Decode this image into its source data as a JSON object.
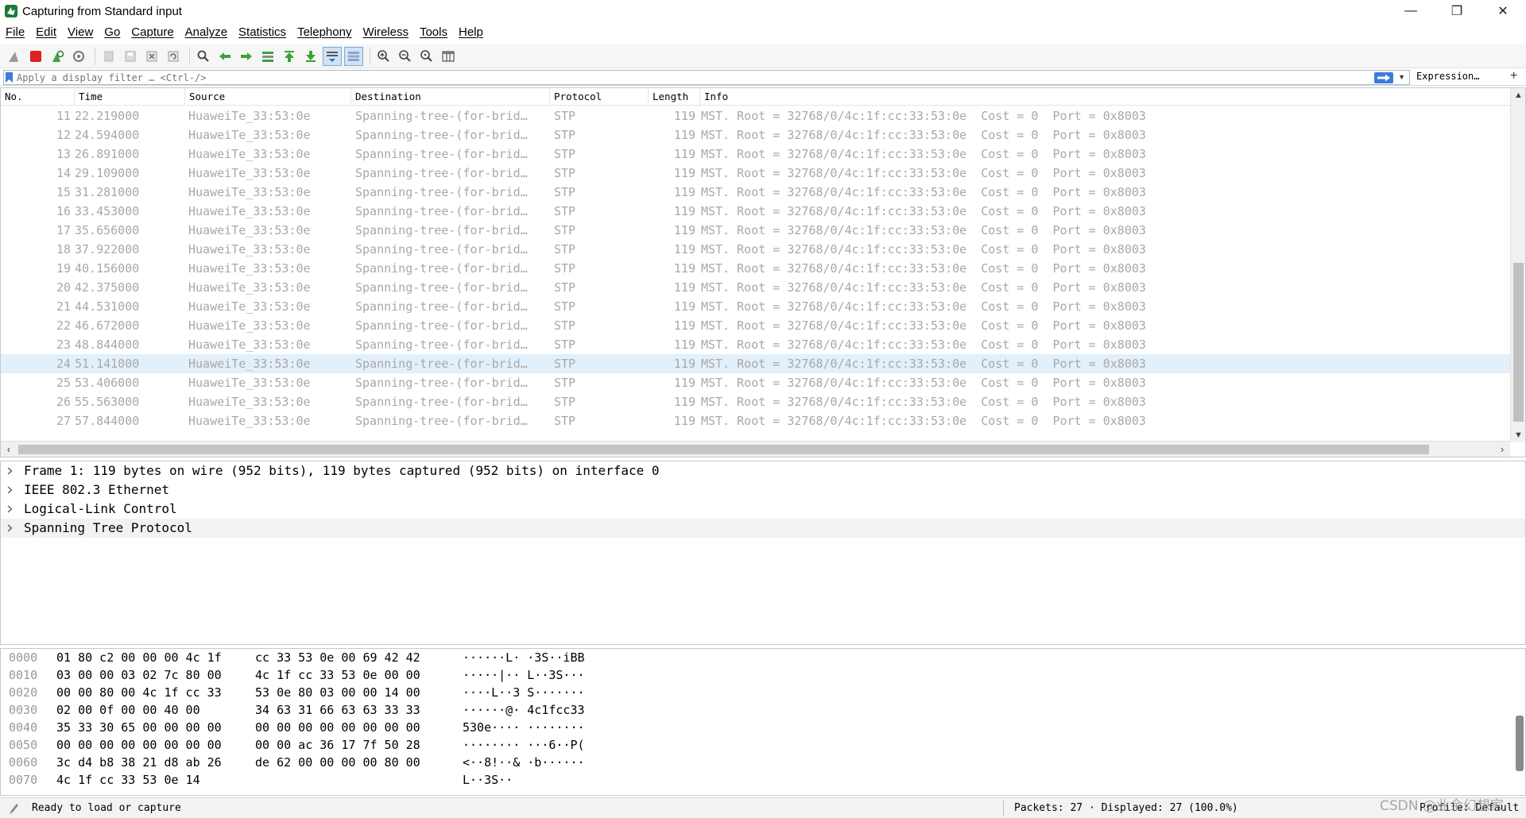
{
  "window": {
    "title": "Capturing from Standard input",
    "controls": [
      "—",
      "❐",
      "✕"
    ]
  },
  "menu": [
    "File",
    "Edit",
    "View",
    "Go",
    "Capture",
    "Analyze",
    "Statistics",
    "Telephony",
    "Wireless",
    "Tools",
    "Help"
  ],
  "toolbar": {
    "icons": [
      "shark-fin-start-icon",
      "stop-capture-icon",
      "restart-capture-icon",
      "capture-options-icon",
      "open-file-icon",
      "save-file-icon",
      "close-file-icon",
      "reload-file-icon",
      "find-packet-icon",
      "go-back-icon",
      "go-forward-icon",
      "go-to-packet-icon",
      "go-first-icon",
      "go-last-icon",
      "auto-scroll-icon",
      "colorize-icon",
      "zoom-in-icon",
      "zoom-out-icon",
      "zoom-normal-icon",
      "resize-columns-icon"
    ]
  },
  "filter": {
    "placeholder": "Apply a display filter … <Ctrl-/>",
    "expression_label": "Expression…",
    "plus_label": "+"
  },
  "packet_list": {
    "columns": [
      "No.",
      "Time",
      "Source",
      "Destination",
      "Protocol",
      "Length",
      "Info"
    ],
    "selected_index": 13,
    "rows": [
      {
        "no": "11",
        "time": "22.219000",
        "src": "HuaweiTe_33:53:0e",
        "dst": "Spanning-tree-(for-brid…",
        "proto": "STP",
        "len": "119",
        "info": "MST. Root = 32768/0/4c:1f:cc:33:53:0e  Cost = 0  Port = 0x8003"
      },
      {
        "no": "12",
        "time": "24.594000",
        "src": "HuaweiTe_33:53:0e",
        "dst": "Spanning-tree-(for-brid…",
        "proto": "STP",
        "len": "119",
        "info": "MST. Root = 32768/0/4c:1f:cc:33:53:0e  Cost = 0  Port = 0x8003"
      },
      {
        "no": "13",
        "time": "26.891000",
        "src": "HuaweiTe_33:53:0e",
        "dst": "Spanning-tree-(for-brid…",
        "proto": "STP",
        "len": "119",
        "info": "MST. Root = 32768/0/4c:1f:cc:33:53:0e  Cost = 0  Port = 0x8003"
      },
      {
        "no": "14",
        "time": "29.109000",
        "src": "HuaweiTe_33:53:0e",
        "dst": "Spanning-tree-(for-brid…",
        "proto": "STP",
        "len": "119",
        "info": "MST. Root = 32768/0/4c:1f:cc:33:53:0e  Cost = 0  Port = 0x8003"
      },
      {
        "no": "15",
        "time": "31.281000",
        "src": "HuaweiTe_33:53:0e",
        "dst": "Spanning-tree-(for-brid…",
        "proto": "STP",
        "len": "119",
        "info": "MST. Root = 32768/0/4c:1f:cc:33:53:0e  Cost = 0  Port = 0x8003"
      },
      {
        "no": "16",
        "time": "33.453000",
        "src": "HuaweiTe_33:53:0e",
        "dst": "Spanning-tree-(for-brid…",
        "proto": "STP",
        "len": "119",
        "info": "MST. Root = 32768/0/4c:1f:cc:33:53:0e  Cost = 0  Port = 0x8003"
      },
      {
        "no": "17",
        "time": "35.656000",
        "src": "HuaweiTe_33:53:0e",
        "dst": "Spanning-tree-(for-brid…",
        "proto": "STP",
        "len": "119",
        "info": "MST. Root = 32768/0/4c:1f:cc:33:53:0e  Cost = 0  Port = 0x8003"
      },
      {
        "no": "18",
        "time": "37.922000",
        "src": "HuaweiTe_33:53:0e",
        "dst": "Spanning-tree-(for-brid…",
        "proto": "STP",
        "len": "119",
        "info": "MST. Root = 32768/0/4c:1f:cc:33:53:0e  Cost = 0  Port = 0x8003"
      },
      {
        "no": "19",
        "time": "40.156000",
        "src": "HuaweiTe_33:53:0e",
        "dst": "Spanning-tree-(for-brid…",
        "proto": "STP",
        "len": "119",
        "info": "MST. Root = 32768/0/4c:1f:cc:33:53:0e  Cost = 0  Port = 0x8003"
      },
      {
        "no": "20",
        "time": "42.375000",
        "src": "HuaweiTe_33:53:0e",
        "dst": "Spanning-tree-(for-brid…",
        "proto": "STP",
        "len": "119",
        "info": "MST. Root = 32768/0/4c:1f:cc:33:53:0e  Cost = 0  Port = 0x8003"
      },
      {
        "no": "21",
        "time": "44.531000",
        "src": "HuaweiTe_33:53:0e",
        "dst": "Spanning-tree-(for-brid…",
        "proto": "STP",
        "len": "119",
        "info": "MST. Root = 32768/0/4c:1f:cc:33:53:0e  Cost = 0  Port = 0x8003"
      },
      {
        "no": "22",
        "time": "46.672000",
        "src": "HuaweiTe_33:53:0e",
        "dst": "Spanning-tree-(for-brid…",
        "proto": "STP",
        "len": "119",
        "info": "MST. Root = 32768/0/4c:1f:cc:33:53:0e  Cost = 0  Port = 0x8003"
      },
      {
        "no": "23",
        "time": "48.844000",
        "src": "HuaweiTe_33:53:0e",
        "dst": "Spanning-tree-(for-brid…",
        "proto": "STP",
        "len": "119",
        "info": "MST. Root = 32768/0/4c:1f:cc:33:53:0e  Cost = 0  Port = 0x8003"
      },
      {
        "no": "24",
        "time": "51.141000",
        "src": "HuaweiTe_33:53:0e",
        "dst": "Spanning-tree-(for-brid…",
        "proto": "STP",
        "len": "119",
        "info": "MST. Root = 32768/0/4c:1f:cc:33:53:0e  Cost = 0  Port = 0x8003"
      },
      {
        "no": "25",
        "time": "53.406000",
        "src": "HuaweiTe_33:53:0e",
        "dst": "Spanning-tree-(for-brid…",
        "proto": "STP",
        "len": "119",
        "info": "MST. Root = 32768/0/4c:1f:cc:33:53:0e  Cost = 0  Port = 0x8003"
      },
      {
        "no": "26",
        "time": "55.563000",
        "src": "HuaweiTe_33:53:0e",
        "dst": "Spanning-tree-(for-brid…",
        "proto": "STP",
        "len": "119",
        "info": "MST. Root = 32768/0/4c:1f:cc:33:53:0e  Cost = 0  Port = 0x8003"
      },
      {
        "no": "27",
        "time": "57.844000",
        "src": "HuaweiTe_33:53:0e",
        "dst": "Spanning-tree-(for-brid…",
        "proto": "STP",
        "len": "119",
        "info": "MST. Root = 32768/0/4c:1f:cc:33:53:0e  Cost = 0  Port = 0x8003"
      }
    ]
  },
  "details": [
    "Frame 1: 119 bytes on wire (952 bits), 119 bytes captured (952 bits) on interface 0",
    "IEEE 802.3 Ethernet",
    "Logical-Link Control",
    "Spanning Tree Protocol"
  ],
  "bytes": [
    {
      "off": "0000",
      "hex1": "01 80 c2 00 00 00 4c 1f",
      "hex2": "cc 33 53 0e 00 69 42 42",
      "ascii": "······L· ·3S··iBB"
    },
    {
      "off": "0010",
      "hex1": "03 00 00 03 02 7c 80 00",
      "hex2": "4c 1f cc 33 53 0e 00 00",
      "ascii": "·····|·· L··3S···"
    },
    {
      "off": "0020",
      "hex1": "00 00 80 00 4c 1f cc 33",
      "hex2": "53 0e 80 03 00 00 14 00",
      "ascii": "····L··3 S·······"
    },
    {
      "off": "0030",
      "hex1": "02 00 0f 00 00 40 00",
      "hex2": "34 63 31 66 63 63 33 33",
      "ascii": "······@· 4c1fcc33"
    },
    {
      "off": "0040",
      "hex1": "35 33 30 65 00 00 00 00",
      "hex2": "00 00 00 00 00 00 00 00",
      "ascii": "530e···· ········"
    },
    {
      "off": "0050",
      "hex1": "00 00 00 00 00 00 00 00",
      "hex2": "00 00 ac 36 17 7f 50 28",
      "ascii": "········ ···6··P("
    },
    {
      "off": "0060",
      "hex1": "3c d4 b8 38 21 d8 ab 26",
      "hex2": "de 62 00 00 00 00 80 00",
      "ascii": "<··8!··& ·b······"
    },
    {
      "off": "0070",
      "hex1": "4c 1f cc 33 53 0e 14",
      "hex2": "",
      "ascii": "L··3S··"
    }
  ],
  "status": {
    "ready": "Ready to load or capture",
    "packets": "Packets: 27 · Displayed: 27 (100.0%)",
    "profile": "Profile: Default",
    "watermark": "CSDN @业余幻想家"
  },
  "colors": {
    "accent": "#3d7bd8",
    "selected_row": "#e2f0fb",
    "row_text": "#a8a8a8",
    "stop_red": "#e0201c"
  }
}
